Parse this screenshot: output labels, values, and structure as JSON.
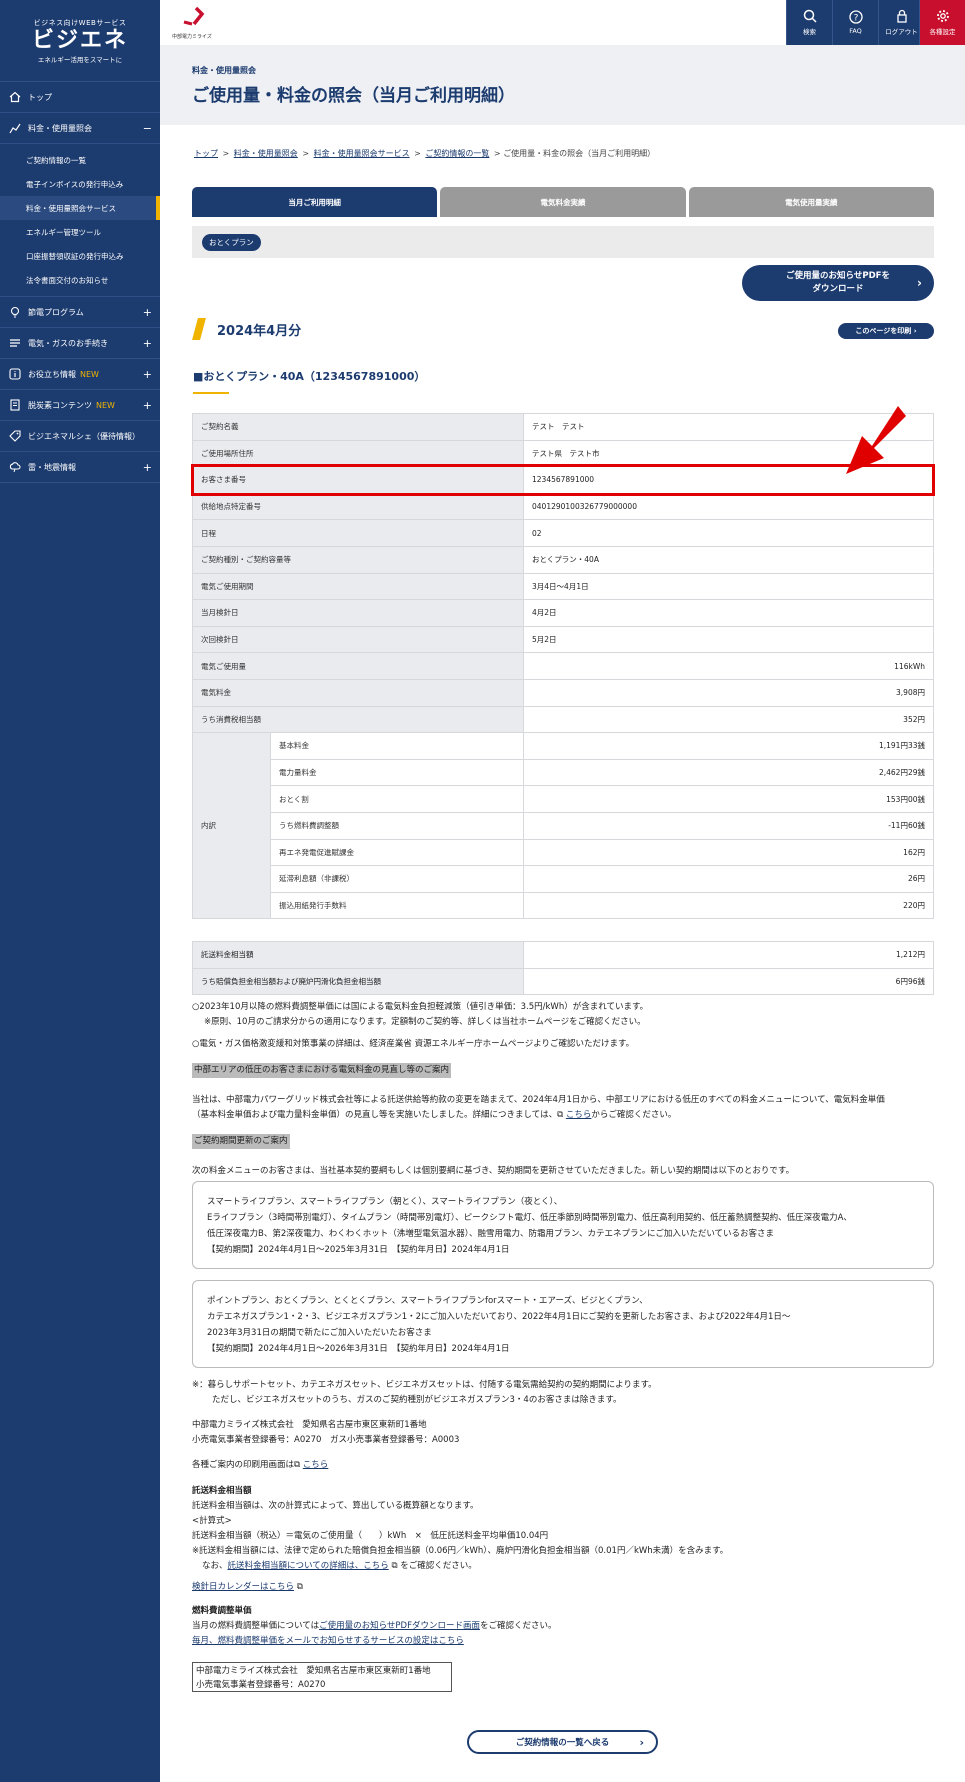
{
  "sidebar": {
    "logo_tag": "ビジネス向けWEBサービス",
    "logo_name": "ビジエネ",
    "logo_sub": "エネルギー活用をスマートに",
    "items": [
      {
        "label": "トップ"
      },
      {
        "label": "料金・使用量照会",
        "toggle": "−"
      },
      {
        "label": "節電プログラム",
        "toggle": "+"
      },
      {
        "label": "電気・ガスのお手続き",
        "toggle": "+"
      },
      {
        "label": "お役立ち情報",
        "new": "NEW",
        "toggle": "+"
      },
      {
        "label": "脱炭素コンテンツ",
        "new": "NEW",
        "toggle": "+"
      },
      {
        "label": "ビジエネマルシェ（優待情報）"
      },
      {
        "label": "雷・地震情報",
        "toggle": "+"
      }
    ],
    "subitems": [
      "ご契約情報の一覧",
      "電子インボイスの発行申込み",
      "料金・使用量照会サービス",
      "エネルギー管理ツール",
      "口座振替領収証の発行申込み",
      "法令書面交付のお知らせ"
    ]
  },
  "topbar": {
    "brand": "中部電力ミライズ",
    "buttons": [
      "検索",
      "FAQ",
      "ログアウト",
      "各種設定"
    ]
  },
  "hero": {
    "sub": "料金・使用量照会",
    "title": "ご使用量・料金の照会（当月ご利用明細）"
  },
  "breadcrumb": {
    "items": [
      "トップ",
      "料金・使用量照会",
      "料金・使用量照会サービス",
      "ご契約情報の一覧"
    ],
    "current": "ご使用量・料金の照会（当月ご利用明細）"
  },
  "tabs": [
    "当月ご利用明細",
    "電気料金実績",
    "電気使用量実績"
  ],
  "plan_pill": "おとくプラン",
  "pdf_button": "ご使用量のお知らせPDFを\nダウンロード",
  "month": "2024年4月分",
  "print_button": "このページを印刷",
  "plan_heading": "■おとくプラン・40A（1234567891000）",
  "info": {
    "rows": [
      {
        "k": "ご契約名義",
        "v": "テスト　テスト"
      },
      {
        "k": "ご使用場所住所",
        "v": "テスト県　テスト市"
      },
      {
        "k": "お客さま番号",
        "v": "1234567891000"
      },
      {
        "k": "供給地点特定番号",
        "v": "0401290100326779000000"
      },
      {
        "k": "日程",
        "v": "02"
      },
      {
        "k": "ご契約種別・ご契約容量等",
        "v": "おとくプラン・40A"
      },
      {
        "k": "電気ご使用期間",
        "v": "3月4日～4月1日"
      },
      {
        "k": "当月検針日",
        "v": "4月2日"
      },
      {
        "k": "次回検針日",
        "v": "5月2日"
      },
      {
        "k": "電気ご使用量",
        "v": "116kWh"
      },
      {
        "k": "電気料金",
        "v": "3,908円"
      },
      {
        "k": "うち消費税相当額",
        "v": "352円"
      }
    ],
    "breakdown_label": "内訳",
    "breakdown": [
      {
        "k": "基本料金",
        "v": "1,191円33銭"
      },
      {
        "k": "電力量料金",
        "v": "2,462円29銭"
      },
      {
        "k": "おとく割",
        "v": "153円00銭"
      },
      {
        "k": "うち燃料費調整額",
        "v": "-11円60銭"
      },
      {
        "k": "再エネ発電促進賦課金",
        "v": "162円"
      },
      {
        "k": "延滞利息額（非課税）",
        "v": "26円"
      },
      {
        "k": "振込用紙発行手数料",
        "v": "220円"
      }
    ]
  },
  "fees": [
    {
      "k": "託送料金相当額",
      "v": "1,212円"
    },
    {
      "k": "うち賠償負担金相当額および廃炉円滑化負担金相当額",
      "v": "6円96銭"
    }
  ],
  "notes": {
    "n1a": "○2023年10月以降の燃料費調整単価には国による電気料金負担軽減策（値引き単価：3.5円/kWh）が含まれています。",
    "n1b": "※原則、10月のご請求分からの適用になります。定額制のご契約等、詳しくは当社ホームページをご確認ください。",
    "n2": "○電気・ガス価格激変緩和対策事業の詳細は、経済産業省 資源エネルギー庁ホームページよりご確認いただけます。",
    "h1": "中部エリアの低圧のお客さまにおける電気料金の見直し等のご案内",
    "p1a": "当社は、中部電力パワーグリッド株式会社等による託送供給等約款の変更を踏まえて、2024年4月1日から、中部エリアにおける低圧のすべての料金メニューについて、電気料金単価",
    "p1b": "（基本料金単価および電力量料金単価）の見直し等を実施いたしました。詳細につきましては、",
    "p1_link": "こちら",
    "p1c": "からご確認ください。",
    "h2": "ご契約期間更新のご案内",
    "p2": "次の料金メニューのお客さまは、当社基本契約要綱もしくは個別要綱に基づき、契約期間を更新させていただきました。新しい契約期間は以下のとおりです。",
    "box1": [
      "スマートライフプラン、スマートライフプラン（朝とく）、スマートライフプラン（夜とく）、",
      "Eライフプラン（3時間帯別電灯）、タイムプラン（時間帯別電灯）、ピークシフト電灯、低圧季節別時間帯別電力、低圧高利用契約、低圧蓄熱調整契約、低圧深夜電力A、",
      "低圧深夜電力B、第2深夜電力、わくわくホット（沸増型電気温水器）、融雪用電力、防霜用プラン、カテエネプランにご加入いただいているお客さま",
      "【契約期間】2024年4月1日～2025年3月31日　【契約年月日】2024年4月1日"
    ],
    "box2": [
      "ポイントプラン、おとくプラン、とくとくプラン、スマートライフプランforスマート・エアーズ、ビジとくプラン、",
      "カテエネガスプラン1・2・3、ビジエネガスプラン1・2にご加入いただいており、2022年4月1日にご契約を更新したお客さま、および2022年4月1日～",
      "2023年3月31日の期間で新たにご加入いただいたお客さま",
      "【契約期間】2024年4月1日～2026年3月31日　【契約年月日】2024年4月1日"
    ],
    "n3a": "※：暮らしサポートセット、カテエネガスセット、ビジエネガスセットは、付随する電気需給契約の契約期間によります。",
    "n3b": "ただし、ビジエネガスセットのうち、ガスのご契約種別がビジエネガスプラン3・4のお客さまは除きます。",
    "addr1": "中部電力ミライズ株式会社　愛知県名古屋市東区東新町1番地",
    "addr2": "小売電気事業者登録番号：A0270　ガス小売事業者登録番号：A0003",
    "print_a": "各種ご案内の印刷用画面は",
    "print_link": "こちら",
    "h3": "託送料金相当額",
    "t1": "託送料金相当額は、次の計算式によって、算出している概算額となります。",
    "t2": "<計算式>",
    "t3": "託送料金相当額（税込）＝電気のご使用量（　　）kWh　×　低圧託送料金平均単価10.04円",
    "t4": "※託送料金相当額には、法律で定められた賠償負担金相当額（0.06円／kWh）、廃炉円滑化負担金相当額（0.01円／kWh未満）を含みます。",
    "t5a": "なお、",
    "t5_link": "託送料金相当額についての詳細は、こちら",
    "t5b": "をご確認ください。",
    "t6_link": "検針日カレンダーはこちら",
    "h4": "燃料費調整単価",
    "f1a": "当月の燃料費調整単価については",
    "f1_link": "ご使用量のお知らせPDFダウンロード画面",
    "f1b": "をご確認ください。",
    "f2_link": "毎月、燃料費調整単価をメールでお知らせするサービスの設定はこちら",
    "box3a": "中部電力ミライズ株式会社　愛知県名古屋市東区東新町1番地",
    "box3b": "小売電気事業者登録番号：A0270"
  },
  "back_button": "ご契約情報の一覧へ戻る",
  "colors": {
    "navy": "#1c3b6f",
    "accent": "#f0b400",
    "alert": "#e00000"
  }
}
